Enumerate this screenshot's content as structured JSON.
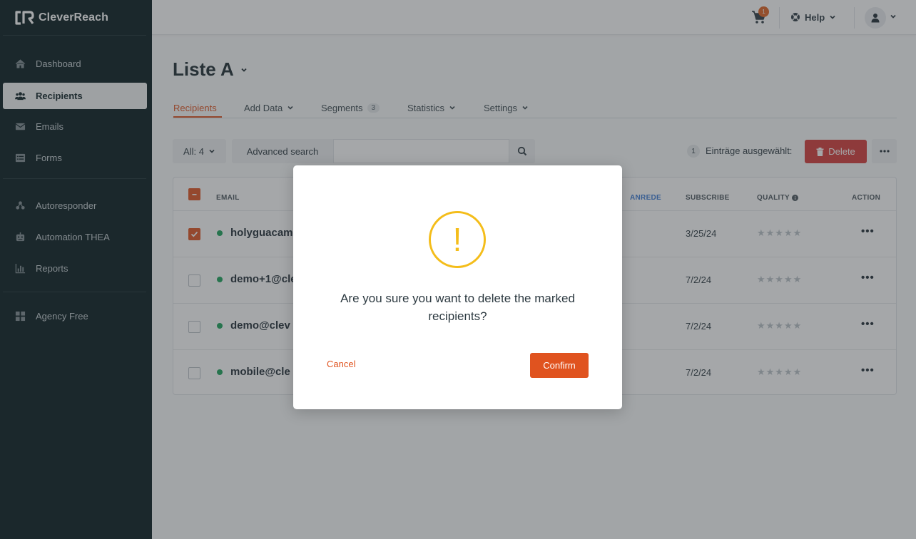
{
  "app": {
    "brand": "CleverReach"
  },
  "sidebar": {
    "items": [
      {
        "label": "Dashboard",
        "icon": "home-icon"
      },
      {
        "label": "Recipients",
        "icon": "users-icon"
      },
      {
        "label": "Emails",
        "icon": "envelope-icon"
      },
      {
        "label": "Forms",
        "icon": "form-icon"
      },
      {
        "label": "Autoresponder",
        "icon": "autoresponder-icon"
      },
      {
        "label": "Automation THEA",
        "icon": "robot-icon"
      },
      {
        "label": "Reports",
        "icon": "chart-icon"
      },
      {
        "label": "Agency Free",
        "icon": "grid-icon"
      }
    ],
    "active": "Recipients"
  },
  "topbar": {
    "cart_count": "1",
    "help_label": "Help"
  },
  "page": {
    "title": "Liste A"
  },
  "tabs": [
    {
      "label": "Recipients"
    },
    {
      "label": "Add Data"
    },
    {
      "label": "Segments",
      "count": "3"
    },
    {
      "label": "Statistics"
    },
    {
      "label": "Settings"
    }
  ],
  "toolbar": {
    "filter_label": "All: 4",
    "advanced_search_label": "Advanced search",
    "search_value": "",
    "selected_count": "1",
    "selected_label": "Einträge ausgewählt:",
    "delete_label": "Delete"
  },
  "table": {
    "headers": {
      "email": "EMAIL",
      "anrede": "ANREDE",
      "subscribe": "SUBSCRIBE",
      "quality": "QUALITY",
      "action": "ACTION"
    },
    "rows": [
      {
        "email": "holyguacam",
        "subscribe": "3/25/24",
        "checked": true,
        "status_color": "#1aa35a",
        "quality": 0
      },
      {
        "email": "demo+1@cle",
        "subscribe": "7/2/24",
        "checked": false,
        "status_color": "#1aa35a",
        "quality": 0
      },
      {
        "email": "demo@clev",
        "subscribe": "7/2/24",
        "checked": false,
        "status_color": "#1aa35a",
        "quality": 0
      },
      {
        "email": "mobile@cle",
        "subscribe": "7/2/24",
        "checked": false,
        "status_color": "#1aa35a",
        "quality": 0
      }
    ]
  },
  "modal": {
    "icon": "warning-icon",
    "message": "Are you sure you want to delete the marked recipients?",
    "cancel_label": "Cancel",
    "confirm_label": "Confirm"
  },
  "colors": {
    "accent": "#e0531f",
    "danger": "#d63a37",
    "warning": "#f4bd1a",
    "sidebar_bg": "#04181c"
  }
}
